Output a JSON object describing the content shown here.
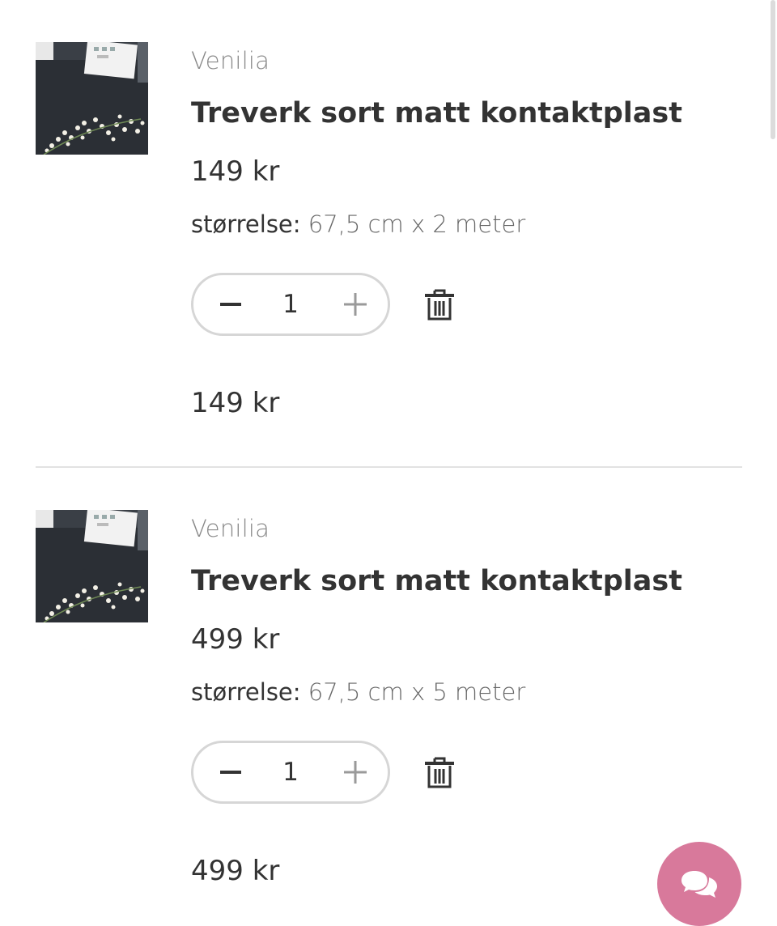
{
  "cart": {
    "items": [
      {
        "brand": "Venilia",
        "title": "Treverk sort matt kontaktplast",
        "price": "149 kr",
        "variant_label": "størrelse:",
        "variant_value": "67,5 cm x 2 meter",
        "quantity": "1",
        "line_total": "149 kr",
        "image_alt": "Treverk sort matt kontaktplast"
      },
      {
        "brand": "Venilia",
        "title": "Treverk sort matt kontaktplast",
        "price": "499 kr",
        "variant_label": "størrelse:",
        "variant_value": "67,5 cm x 5 meter",
        "quantity": "1",
        "line_total": "499 kr",
        "image_alt": "Treverk sort matt kontaktplast"
      }
    ]
  },
  "icons": {
    "decrease": "minus-icon",
    "increase": "plus-icon",
    "remove": "trash-icon",
    "chat": "chat-bubbles-icon"
  },
  "colors": {
    "chat_button": "#d8799b",
    "text": "#333333",
    "muted": "#888888",
    "stepper_border": "#d6d6d6"
  }
}
